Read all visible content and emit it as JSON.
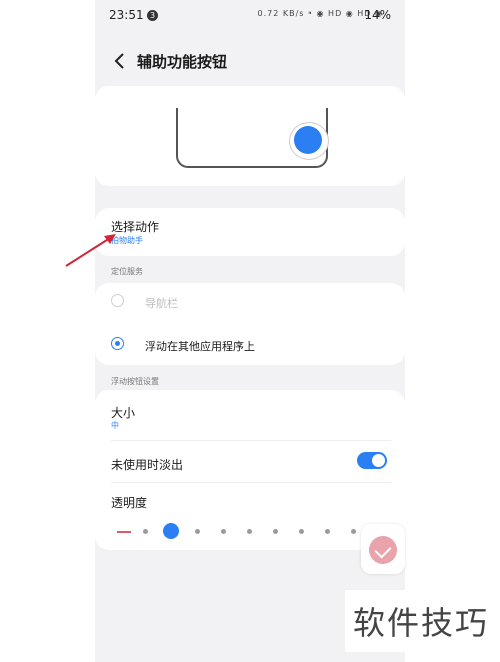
{
  "statusbar": {
    "time": "23:51",
    "notification_badge": "3",
    "icons_text": "0.72 KB/s ⁍ ◉ HD ◉ HD ◉",
    "battery": "14%"
  },
  "header": {
    "back_icon": "back-arrow-icon",
    "title": "辅助功能按钮"
  },
  "action": {
    "label": "选择动作",
    "value": "拍物助手"
  },
  "section_position": {
    "label": "定位服务",
    "options": [
      {
        "label": "导航栏",
        "selected": false,
        "enabled": false
      },
      {
        "label": "浮动在其他应用程序上",
        "selected": true,
        "enabled": true
      }
    ]
  },
  "section_float": {
    "label": "浮动按钮设置",
    "size_label": "大小",
    "size_value": "中",
    "fade_label": "未使用时淡出",
    "fade_enabled": true,
    "opacity_label": "透明度",
    "opacity_level": 1,
    "opacity_steps": 9
  },
  "watermark": {
    "text": "软件技巧"
  },
  "colors": {
    "accent": "#2b7ff2",
    "minus": "#e05a67",
    "arrow": "#d0263a"
  }
}
